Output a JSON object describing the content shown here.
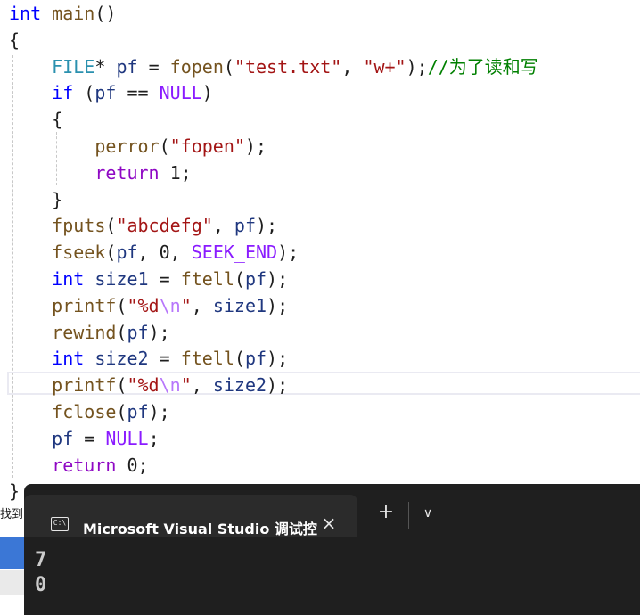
{
  "editor": {
    "lines": [
      [
        {
          "t": "int",
          "c": "kw"
        },
        {
          "t": " ",
          "c": "pl"
        },
        {
          "t": "main",
          "c": "fn"
        },
        {
          "t": "()",
          "c": "pl"
        }
      ],
      [
        {
          "t": "{",
          "c": "pl"
        }
      ],
      [
        {
          "t": "    ",
          "c": "pl"
        },
        {
          "t": "FILE",
          "c": "ty"
        },
        {
          "t": "* ",
          "c": "pl"
        },
        {
          "t": "pf",
          "c": "var"
        },
        {
          "t": " = ",
          "c": "pl"
        },
        {
          "t": "fopen",
          "c": "fn"
        },
        {
          "t": "(",
          "c": "pl"
        },
        {
          "t": "\"test.txt\"",
          "c": "str"
        },
        {
          "t": ", ",
          "c": "pl"
        },
        {
          "t": "\"w+\"",
          "c": "str"
        },
        {
          "t": ");",
          "c": "pl"
        },
        {
          "t": "//为了读和写",
          "c": "cm"
        }
      ],
      [
        {
          "t": "    ",
          "c": "pl"
        },
        {
          "t": "if",
          "c": "kw"
        },
        {
          "t": " (",
          "c": "pl"
        },
        {
          "t": "pf",
          "c": "var"
        },
        {
          "t": " == ",
          "c": "pl"
        },
        {
          "t": "NULL",
          "c": "mac"
        },
        {
          "t": ")",
          "c": "pl"
        }
      ],
      [
        {
          "t": "    {",
          "c": "pl"
        }
      ],
      [
        {
          "t": "        ",
          "c": "pl"
        },
        {
          "t": "perror",
          "c": "fn"
        },
        {
          "t": "(",
          "c": "pl"
        },
        {
          "t": "\"fopen\"",
          "c": "str"
        },
        {
          "t": ");",
          "c": "pl"
        }
      ],
      [
        {
          "t": "        ",
          "c": "pl"
        },
        {
          "t": "return",
          "c": "ctl"
        },
        {
          "t": " 1;",
          "c": "pl"
        }
      ],
      [
        {
          "t": "    }",
          "c": "pl"
        }
      ],
      [
        {
          "t": "    ",
          "c": "pl"
        },
        {
          "t": "fputs",
          "c": "fn"
        },
        {
          "t": "(",
          "c": "pl"
        },
        {
          "t": "\"abcdefg\"",
          "c": "str"
        },
        {
          "t": ", ",
          "c": "pl"
        },
        {
          "t": "pf",
          "c": "var"
        },
        {
          "t": ");",
          "c": "pl"
        }
      ],
      [
        {
          "t": "    ",
          "c": "pl"
        },
        {
          "t": "fseek",
          "c": "fn"
        },
        {
          "t": "(",
          "c": "pl"
        },
        {
          "t": "pf",
          "c": "var"
        },
        {
          "t": ", 0, ",
          "c": "pl"
        },
        {
          "t": "SEEK_END",
          "c": "mac"
        },
        {
          "t": ");",
          "c": "pl"
        }
      ],
      [
        {
          "t": "    ",
          "c": "pl"
        },
        {
          "t": "int",
          "c": "kw"
        },
        {
          "t": " ",
          "c": "pl"
        },
        {
          "t": "size1",
          "c": "var"
        },
        {
          "t": " = ",
          "c": "pl"
        },
        {
          "t": "ftell",
          "c": "fn"
        },
        {
          "t": "(",
          "c": "pl"
        },
        {
          "t": "pf",
          "c": "var"
        },
        {
          "t": ");",
          "c": "pl"
        }
      ],
      [
        {
          "t": "    ",
          "c": "pl"
        },
        {
          "t": "printf",
          "c": "fn"
        },
        {
          "t": "(",
          "c": "pl"
        },
        {
          "t": "\"%d",
          "c": "str"
        },
        {
          "t": "\\n",
          "c": "esc"
        },
        {
          "t": "\"",
          "c": "str"
        },
        {
          "t": ", ",
          "c": "pl"
        },
        {
          "t": "size1",
          "c": "var"
        },
        {
          "t": ");",
          "c": "pl"
        }
      ],
      [
        {
          "t": "    ",
          "c": "pl"
        },
        {
          "t": "rewind",
          "c": "fn"
        },
        {
          "t": "(",
          "c": "pl"
        },
        {
          "t": "pf",
          "c": "var"
        },
        {
          "t": ");",
          "c": "pl"
        }
      ],
      [
        {
          "t": "    ",
          "c": "pl"
        },
        {
          "t": "int",
          "c": "kw"
        },
        {
          "t": " ",
          "c": "pl"
        },
        {
          "t": "size2",
          "c": "var"
        },
        {
          "t": " = ",
          "c": "pl"
        },
        {
          "t": "ftell",
          "c": "fn"
        },
        {
          "t": "(",
          "c": "pl"
        },
        {
          "t": "pf",
          "c": "var"
        },
        {
          "t": ");",
          "c": "pl"
        }
      ],
      [
        {
          "t": "    ",
          "c": "pl"
        },
        {
          "t": "printf",
          "c": "fn"
        },
        {
          "t": "(",
          "c": "pl"
        },
        {
          "t": "\"%d",
          "c": "str"
        },
        {
          "t": "\\n",
          "c": "esc"
        },
        {
          "t": "\"",
          "c": "str"
        },
        {
          "t": ", ",
          "c": "pl"
        },
        {
          "t": "size2",
          "c": "var"
        },
        {
          "t": ");",
          "c": "pl"
        }
      ],
      [
        {
          "t": "    ",
          "c": "pl"
        },
        {
          "t": "fclose",
          "c": "fn"
        },
        {
          "t": "(",
          "c": "pl"
        },
        {
          "t": "pf",
          "c": "var"
        },
        {
          "t": ");",
          "c": "pl"
        }
      ],
      [
        {
          "t": "    ",
          "c": "pl"
        },
        {
          "t": "pf",
          "c": "var"
        },
        {
          "t": " = ",
          "c": "pl"
        },
        {
          "t": "NULL",
          "c": "mac"
        },
        {
          "t": ";",
          "c": "pl"
        }
      ],
      [
        {
          "t": "    ",
          "c": "pl"
        },
        {
          "t": "return",
          "c": "ctl"
        },
        {
          "t": " 0;",
          "c": "pl"
        }
      ],
      [
        {
          "t": "}",
          "c": "pl"
        }
      ]
    ]
  },
  "sidebar": {
    "label": "找到"
  },
  "console": {
    "tab_title": "Microsoft Visual Studio 调试控",
    "tab_icon_label": "C:\\",
    "close_icon": "×",
    "add_icon": "+",
    "dropdown_icon": "∨",
    "output": [
      "7",
      "0"
    ]
  },
  "colors": {
    "keyword": "#0000ff",
    "type": "#2b91af",
    "function": "#74531f",
    "variable": "#1f377f",
    "string": "#a31515",
    "escape": "#b776fb",
    "macro": "#8a1bff",
    "comment": "#008000",
    "control": "#8f08c4",
    "console_bg": "#1f1f1f",
    "console_tab": "#2b2b2b"
  }
}
